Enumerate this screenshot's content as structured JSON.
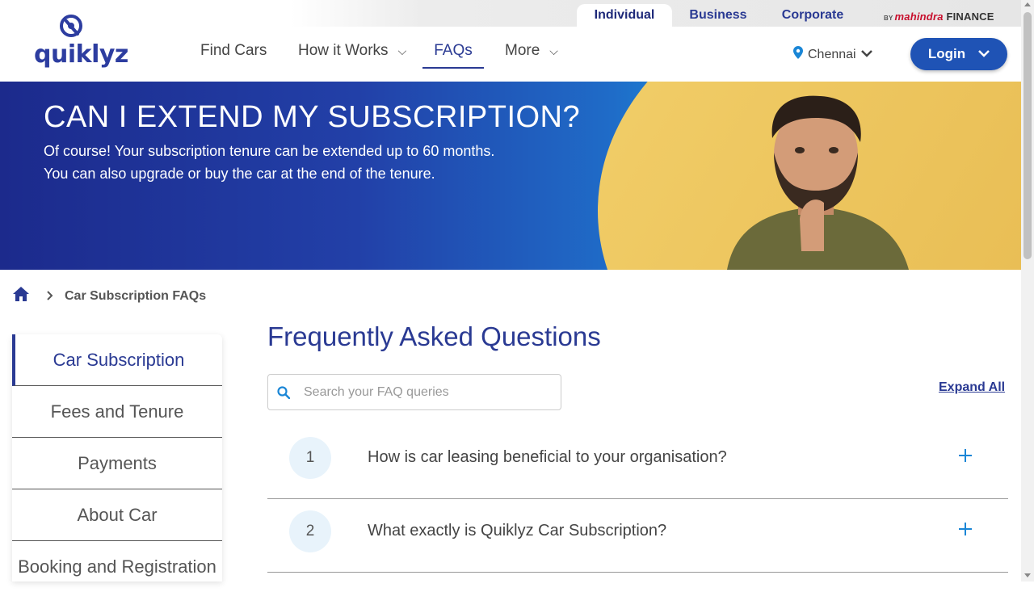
{
  "topbar": {
    "tabs": [
      "Individual",
      "Business",
      "Corporate"
    ],
    "active_tab": "Individual",
    "brand_prefix": "BY",
    "brand_name": "mahindra",
    "brand_suffix": "FINANCE"
  },
  "logo": {
    "text": "quiklyz"
  },
  "nav": {
    "find_cars": "Find Cars",
    "how_it_works": "How it Works",
    "faqs": "FAQs",
    "more": "More"
  },
  "location": {
    "city": "Chennai"
  },
  "login": {
    "label": "Login"
  },
  "hero": {
    "title": "CAN I EXTEND MY SUBSCRIPTION?",
    "line1": "Of course! Your subscription tenure can be extended up to 60 months.",
    "line2": "You can also upgrade or buy the car at the end of the tenure."
  },
  "breadcrumb": {
    "current": "Car Subscription FAQs"
  },
  "sidebar": {
    "items": [
      {
        "label": "Car Subscription"
      },
      {
        "label": "Fees and Tenure"
      },
      {
        "label": "Payments"
      },
      {
        "label": "About Car"
      },
      {
        "label": "Booking and Registration"
      }
    ]
  },
  "main": {
    "title": "Frequently Asked Questions",
    "search_placeholder": "Search your FAQ queries",
    "expand_all": "Expand All",
    "questions": [
      {
        "num": "1",
        "text": "How is car leasing beneficial to your organisation?"
      },
      {
        "num": "2",
        "text": "What exactly is Quiklyz Car Subscription?"
      }
    ]
  },
  "colors": {
    "primary": "#2a3a93",
    "accent": "#1a86d6",
    "login_bg": "#1f53b5"
  }
}
